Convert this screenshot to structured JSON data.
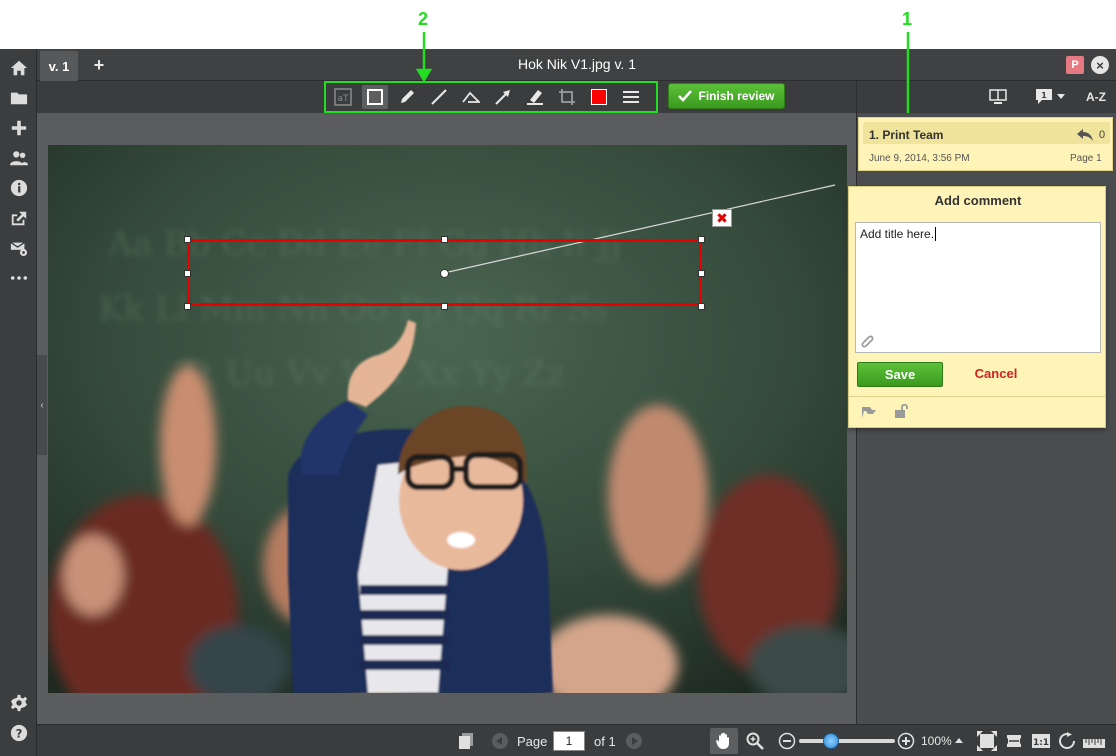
{
  "guides": {
    "marker_2": "2",
    "marker_1": "1",
    "color": "#22dd22"
  },
  "tabbar": {
    "version_tab": "v. 1",
    "add_tab_glyph": "+",
    "title": "Hok Nik V1.jpg v. 1",
    "user_badge": "P",
    "close_glyph": "×"
  },
  "left_rail": {
    "items": [
      {
        "icon": "home-icon"
      },
      {
        "icon": "folder-icon"
      },
      {
        "icon": "plus-icon"
      },
      {
        "icon": "users-icon"
      },
      {
        "icon": "info-icon"
      },
      {
        "icon": "share-icon"
      },
      {
        "icon": "mail-settings-icon"
      },
      {
        "icon": "more-icon"
      }
    ],
    "bottom": [
      {
        "icon": "gear-icon"
      },
      {
        "icon": "help-icon"
      }
    ]
  },
  "toolbar": {
    "tools": [
      "text-tool-icon",
      "rectangle-tool-icon",
      "pencil-tool-icon",
      "line-tool-icon",
      "polyline-tool-icon",
      "arrow-tool-icon",
      "highlighter-tool-icon",
      "crop-tool-icon",
      "color-swatch",
      "line-weight-icon"
    ],
    "active_tool": "rectangle-tool-icon",
    "accent_color": "#ff0000",
    "finish_label": "Finish review"
  },
  "right_header": {
    "sort_label": "A-Z",
    "comment_count": "1"
  },
  "comment": {
    "title": "1. Print Team",
    "reply_count": "0",
    "date": "June 9, 2014, 3:56 PM",
    "page": "Page 1"
  },
  "add_comment": {
    "heading": "Add comment",
    "text": "Add title here.",
    "save_label": "Save",
    "cancel_label": "Cancel"
  },
  "bottom_bar": {
    "page_label": "Page",
    "page_value": "1",
    "of_label": "of 1",
    "zoom_level": "100%",
    "zoom_fraction": 0.33
  }
}
